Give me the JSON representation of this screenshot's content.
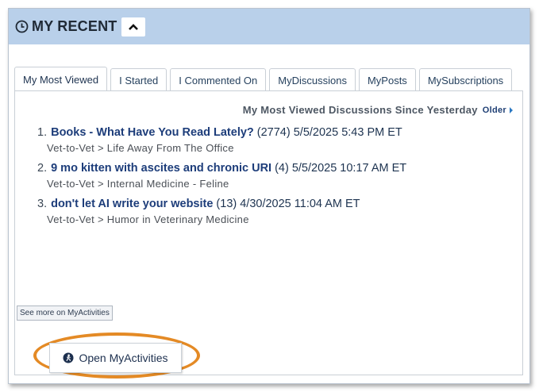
{
  "header": {
    "title": "MY RECENT"
  },
  "tabs": [
    {
      "label": "My Most Viewed",
      "active": true
    },
    {
      "label": "I Started",
      "active": false
    },
    {
      "label": "I Commented On",
      "active": false
    },
    {
      "label": "MyDiscussions",
      "active": false
    },
    {
      "label": "MyPosts",
      "active": false
    },
    {
      "label": "MySubscriptions",
      "active": false
    }
  ],
  "panel": {
    "subheader": "My Most Viewed Discussions Since Yesterday",
    "older_label": "Older"
  },
  "items": [
    {
      "num": "1.",
      "title": "Books - What Have You Read Lately?",
      "meta": "(2774) 5/5/2025 5:43 PM ET",
      "path": "Vet-to-Vet > Life Away From The Office"
    },
    {
      "num": "2.",
      "title": "9 mo kitten with ascites and chronic URI",
      "meta": "(4) 5/5/2025 10:17 AM ET",
      "path": "Vet-to-Vet > Internal Medicine - Feline"
    },
    {
      "num": "3.",
      "title": "don't let AI write your website",
      "meta": "(13) 4/30/2025 11:04 AM ET",
      "path": "Vet-to-Vet > Humor in Veterinary Medicine"
    }
  ],
  "see_more_label": "See more on MyActivities",
  "open_button_label": "Open MyActivities",
  "colors": {
    "header_bg": "#b9d0ea",
    "highlight": "#e48a25",
    "link": "#1d3d7a"
  },
  "icons": {
    "header": "clock-icon",
    "collapse": "chevron-up-icon",
    "open": "activity-person-icon"
  }
}
